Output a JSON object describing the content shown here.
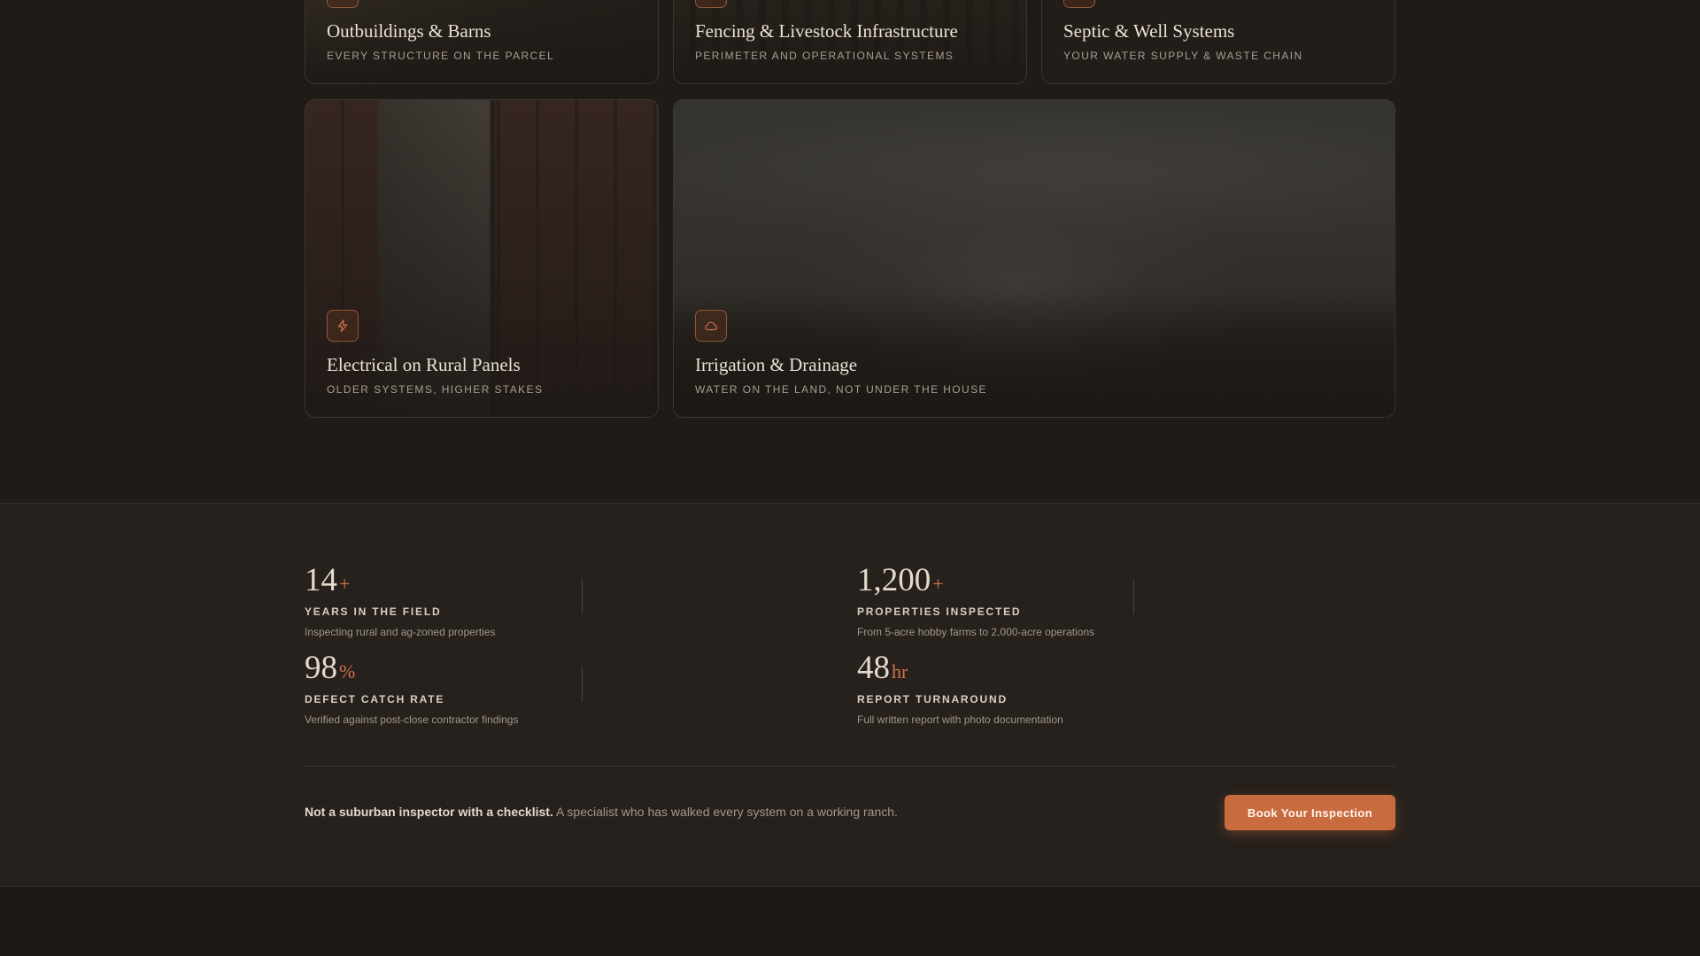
{
  "services": {
    "outbuildings": {
      "title": "Outbuildings & Barns",
      "subtitle": "EVERY STRUCTURE ON THE PARCEL",
      "icon": "barn-icon"
    },
    "fencing": {
      "title": "Fencing & Livestock Infrastructure",
      "subtitle": "PERIMETER AND OPERATIONAL SYSTEMS",
      "icon": "fence-icon"
    },
    "septic": {
      "title": "Septic & Well Systems",
      "subtitle": "YOUR WATER SUPPLY & WASTE CHAIN",
      "icon": "water-drop-icon"
    },
    "electrical": {
      "title": "Electrical on Rural Panels",
      "subtitle": "OLDER SYSTEMS, HIGHER STAKES",
      "icon": "lightning-icon"
    },
    "irrigation": {
      "title": "Irrigation & Drainage",
      "subtitle": "WATER ON THE LAND, NOT UNDER THE HOUSE",
      "icon": "cloud-icon"
    }
  },
  "stats": [
    {
      "value": "14",
      "suffix": "+",
      "label": "YEARS IN THE FIELD",
      "desc": "Inspecting rural and ag-zoned properties"
    },
    {
      "value": "1,200",
      "suffix": "+",
      "label": "PROPERTIES INSPECTED",
      "desc": "From 5-acre hobby farms to 2,000-acre operations"
    },
    {
      "value": "98",
      "suffix": "%",
      "label": "DEFECT CATCH RATE",
      "desc": "Verified against post-close contractor findings"
    },
    {
      "value": "48",
      "suffix": "hr",
      "label": "REPORT TURNAROUND",
      "desc": "Full written report with photo documentation"
    }
  ],
  "cta_bar": {
    "bold": "Not a suburban inspector with a checklist.",
    "rest": "A specialist who has walked every system on a working ranch.",
    "button": "Book Your Inspection"
  },
  "colors": {
    "accent": "#c86c40",
    "background": "#1f1b17",
    "panel": "#26211c"
  }
}
